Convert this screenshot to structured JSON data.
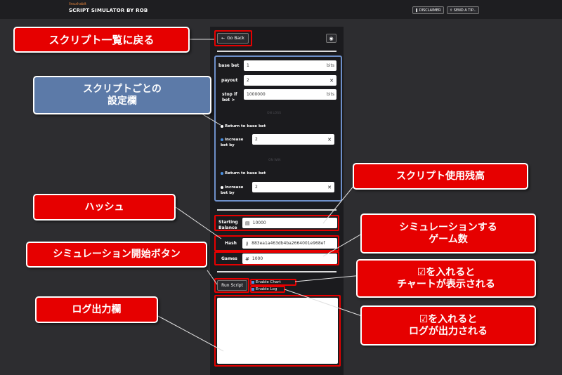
{
  "header": {
    "brand_small": "linuxhabit",
    "brand": "SCRIPT SIMULATOR BY ROB",
    "disclaimer": "DISCLAIMER",
    "send_tip": "SEND A TIP..."
  },
  "toolbar": {
    "go_back": "Go Back",
    "eye_icon": "eye-icon"
  },
  "settings": {
    "base_bet_label": "base bet",
    "base_bet_value": "1",
    "base_bet_unit": "bits",
    "payout_label": "payout",
    "payout_value": "2",
    "stop_label": "stop if bet >",
    "stop_value": "1000000",
    "stop_unit": "bits",
    "on_loss": "ON LOSS",
    "on_win": "ON WIN",
    "return_base": "Return to base bet",
    "increase_by": "Increase bet by",
    "loss_increase_value": "2",
    "win_increase_value": "2"
  },
  "sim": {
    "starting_balance_label": "Starting Balance",
    "starting_balance_value": "10000",
    "hash_label": "Hash",
    "hash_value": "883ea1a463db4ba2664001e968ef",
    "games_label": "Games",
    "games_value": "1000",
    "run_script": "Run Script",
    "enable_chart": "Enable Chart",
    "enable_log": "Enable Log"
  },
  "annotations": {
    "back_to_list": "スクリプト一覧に戻る",
    "per_script_settings": "スクリプトごとの\n設定欄",
    "script_balance": "スクリプト使用残高",
    "hash": "ハッシュ",
    "game_count": "シミュレーションする\nゲーム数",
    "start_button": "シミュレーション開始ボタン",
    "chart_check": "☑を入れると\nチャートが表示される",
    "log_area": "ログ出力欄",
    "log_check": "☑を入れると\nログが出力される"
  },
  "colors": {
    "callout_red": "#e60000",
    "callout_blue": "#5c7aa8",
    "panel": "#1b1b1e",
    "radio_blue": "#4a90e2"
  }
}
